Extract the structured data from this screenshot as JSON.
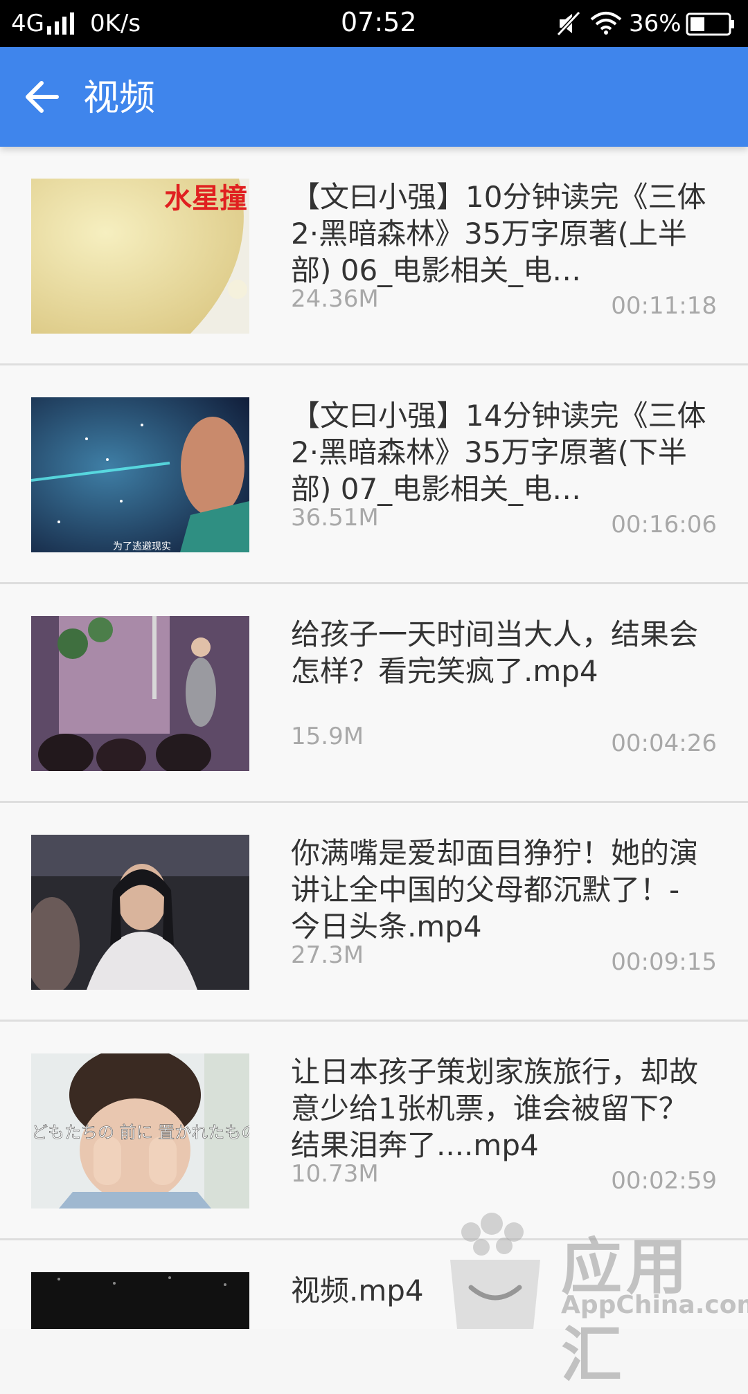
{
  "status_bar": {
    "network": "4G",
    "speed": "0K/s",
    "time": "07:52",
    "battery": "36%"
  },
  "app_bar": {
    "title": "视频",
    "color": "#3f85ec"
  },
  "videos": [
    {
      "title": "【文曰小强】10分钟读完《三体2·黑暗森林》35万字原著(上半部) 06_电影相关_电…",
      "size": "24.36M",
      "duration": "00:11:18",
      "thumb_overlay": "水星撞"
    },
    {
      "title": "【文曰小强】14分钟读完《三体2·黑暗森林》35万字原著(下半部) 07_电影相关_电…",
      "size": "36.51M",
      "duration": "00:16:06",
      "thumb_overlay": "为了逃避现实"
    },
    {
      "title": "给孩子一天时间当大人，结果会怎样？看完笑疯了.mp4",
      "size": "15.9M",
      "duration": "00:04:26"
    },
    {
      "title": "你满嘴是爱却面目狰狞！她的演讲让全中国的父母都沉默了！-今日头条.mp4",
      "size": "27.3M",
      "duration": "00:09:15"
    },
    {
      "title": "让日本孩子策划家族旅行，却故意少给1张机票，谁会被留下？结果泪奔了....mp4",
      "size": "10.73M",
      "duration": "00:02:59",
      "thumb_overlay": "どもたちの 前に 置かれたもの"
    },
    {
      "title": "视频.mp4",
      "size": "",
      "duration": ""
    }
  ],
  "watermark": {
    "cn": "应用汇",
    "en": "AppChina.com"
  }
}
